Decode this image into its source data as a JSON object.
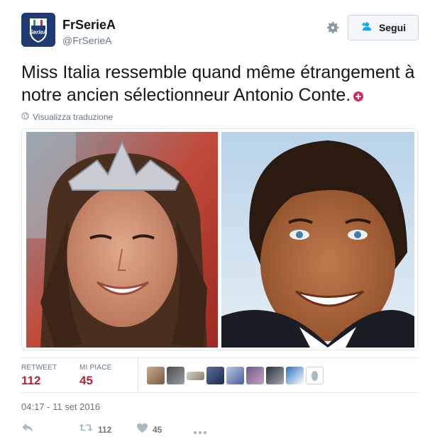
{
  "account": {
    "display_name": "FrSerieA",
    "screen_name": "@FrSerieA",
    "avatar_icon": "serie-a-shield-logo"
  },
  "follow_button": {
    "label": "Segui",
    "icon": "add-user-icon"
  },
  "settings_icon": "gear-icon",
  "tweet": {
    "text": "Miss Italia ressemble quand même étrangement à notre ancien sélectionneur Antonio Conte.",
    "emoji_icon": "red-plus-circle-icon"
  },
  "translate": {
    "label": "Visualizza traduzione",
    "icon": "globe-icon"
  },
  "media": {
    "left_photo": "woman-wearing-tiara-photo",
    "right_photo": "smiling-man-photo"
  },
  "stats": {
    "retweets_label": "RETWEET",
    "retweets_count": "112",
    "likes_label": "MI PIACE",
    "likes_count": "45",
    "likers_count": 9
  },
  "timestamp": "04:17 - 11 set 2016",
  "actions": {
    "reply_icon": "reply-icon",
    "retweet_icon": "retweet-icon",
    "retweet_count": "112",
    "like_icon": "heart-icon",
    "like_count": "45",
    "more_icon": "more-icon"
  },
  "colors": {
    "stat_value": "#b0263d",
    "secondary_text": "#657786",
    "border": "#e1e8ed"
  }
}
